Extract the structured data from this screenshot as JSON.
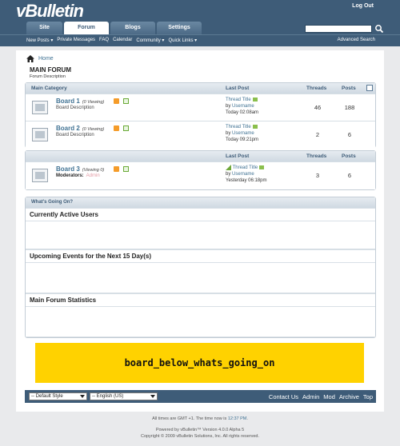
{
  "header": {
    "logo": "vBulletin",
    "logout": "Log Out",
    "tabs": [
      "Site",
      "Forum",
      "Blogs",
      "Settings"
    ],
    "subnav": [
      "New Posts ▾",
      "Private Messages",
      "FAQ",
      "Calendar",
      "Community ▾",
      "Quick Links ▾"
    ],
    "advanced_search": "Advanced Search"
  },
  "breadcrumb": {
    "home": "Home"
  },
  "forum": {
    "title": "MAIN FORUM",
    "description": "Forum Description"
  },
  "table": {
    "category": "Main Category",
    "last_post": "Last Post",
    "threads": "Threads",
    "posts": "Posts"
  },
  "boards": [
    {
      "name": "Board 1",
      "viewing": "(0 Viewing)",
      "desc": "Board Description",
      "thread": "Thread Title",
      "by": "by",
      "user": "Username",
      "time": "Today 02:08am",
      "threads": "46",
      "posts": "188"
    },
    {
      "name": "Board 2",
      "viewing": "(0 Viewing)",
      "desc": "Board Description",
      "thread": "Thread Title",
      "by": "by",
      "user": "Username",
      "time": "Today 09:21pm",
      "threads": "2",
      "posts": "6"
    }
  ],
  "board3": {
    "name": "Board 3",
    "viewing": "(Viewing 0)",
    "mods_label": "Moderators:",
    "mods_value": "Admin",
    "thread": "Thread Title",
    "by": "by",
    "user": "Username",
    "time": "Yesterday 06:18pm",
    "threads": "3",
    "posts": "6"
  },
  "wgo": {
    "title": "What's Going On?",
    "sections": [
      "Currently Active Users",
      "Upcoming Events for the Next 15 Day(s)",
      "Main Forum Statistics"
    ]
  },
  "ad": "board_below_whats_going_on",
  "footer": {
    "style_select": "-- Default Style",
    "lang_select": "-- English (US)",
    "links": [
      "Contact Us",
      "Admin",
      "Mod",
      "Archive",
      "Top"
    ],
    "time": "All times are GMT +1. The time now is",
    "time_value": "12:37 PM",
    "powered": "Powered by vBulletin™ Version 4.0.0 Alpha 5",
    "copyright": "Copyright © 2009 vBulletin Solutions, Inc. All rights reserved."
  }
}
